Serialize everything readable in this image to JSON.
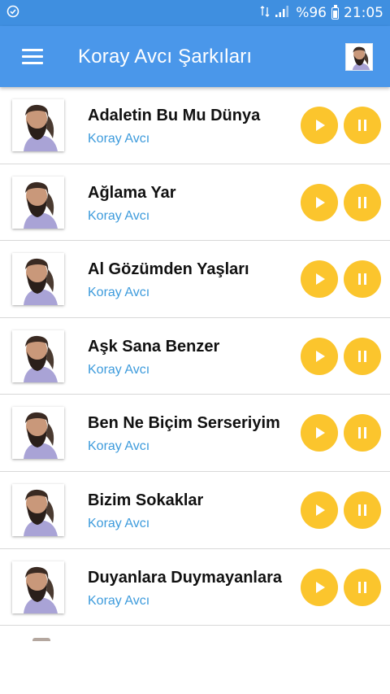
{
  "status_bar": {
    "signal_text": "%96",
    "time": "21:05",
    "icons": [
      "shield-check-icon",
      "data-arrows-icon",
      "signal-icon",
      "battery-charging-icon"
    ]
  },
  "app_bar": {
    "title": "Koray Avcı Şarkıları",
    "menu_icon": "hamburger-menu-icon",
    "avatar_icon": "artist-avatar"
  },
  "colors": {
    "status_bar": "#3f8fe0",
    "app_bar": "#4a97ea",
    "button": "#fbc52d",
    "artist": "#3d9bdc"
  },
  "songs": [
    {
      "title": "Adaletin Bu Mu Dünya",
      "artist": "Koray Avcı"
    },
    {
      "title": "Ağlama Yar",
      "artist": "Koray Avcı"
    },
    {
      "title": "Al Gözümden Yaşları",
      "artist": "Koray Avcı"
    },
    {
      "title": "Aşk Sana Benzer",
      "artist": "Koray Avcı"
    },
    {
      "title": "Ben Ne Biçim Serseriyim",
      "artist": "Koray Avcı"
    },
    {
      "title": "Bizim Sokaklar",
      "artist": "Koray Avcı"
    },
    {
      "title": "Duyanlara Duymayanlara",
      "artist": "Koray Avcı"
    }
  ]
}
